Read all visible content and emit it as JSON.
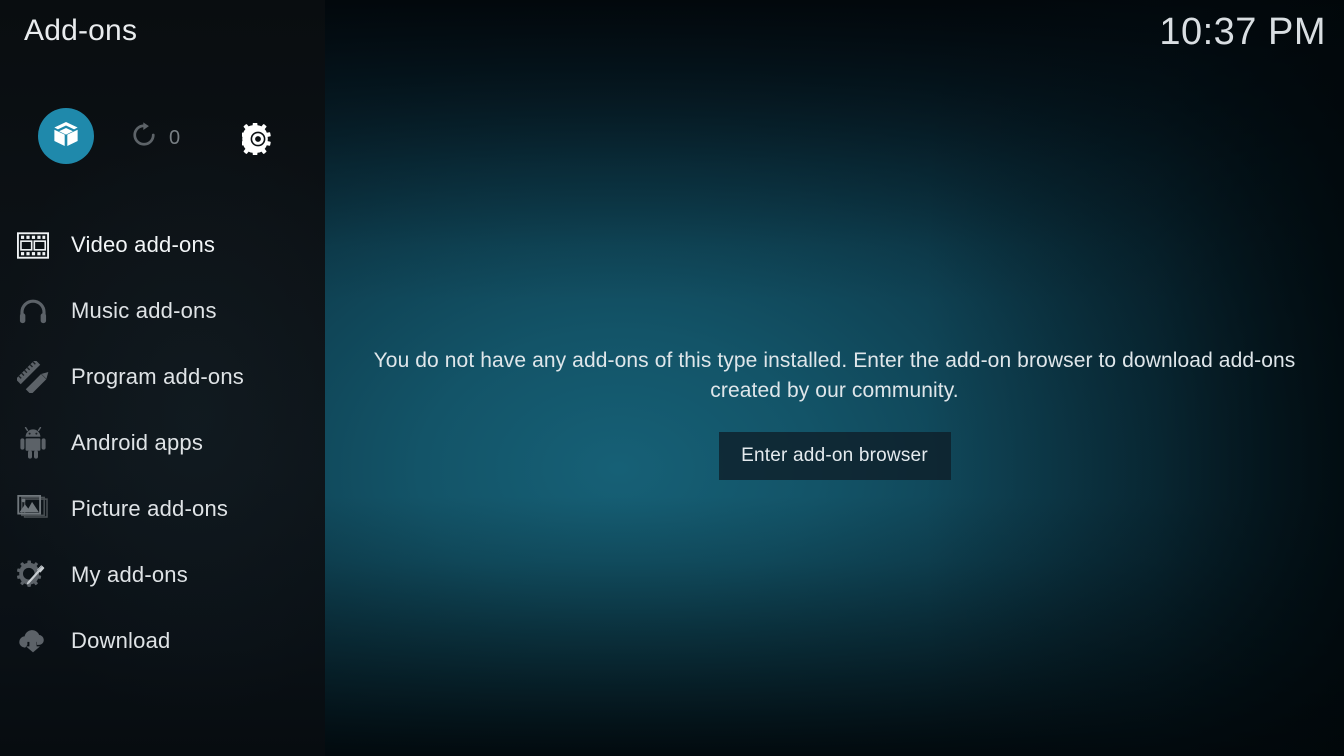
{
  "header": {
    "title": "Add-ons",
    "clock": "10:37 PM"
  },
  "toolbar": {
    "addons_icon": "package-box-icon",
    "update_icon": "refresh-arrow-icon",
    "update_count": "0",
    "settings_icon": "gear-icon"
  },
  "sidebar": {
    "items": [
      {
        "label": "Video add-ons",
        "icon": "film-strip-icon",
        "selected": true
      },
      {
        "label": "Music add-ons",
        "icon": "headphones-icon",
        "selected": false
      },
      {
        "label": "Program add-ons",
        "icon": "pencil-ruler-icon",
        "selected": false
      },
      {
        "label": "Android apps",
        "icon": "android-robot-icon",
        "selected": false
      },
      {
        "label": "Picture add-ons",
        "icon": "picture-frame-icon",
        "selected": false
      },
      {
        "label": "My add-ons",
        "icon": "gear-screwdriver-icon",
        "selected": false
      },
      {
        "label": "Download",
        "icon": "cloud-download-icon",
        "selected": false
      }
    ]
  },
  "main": {
    "empty_message": "You do not have any add-ons of this type installed. Enter the add-on browser to download add-ons created by our community.",
    "browser_button_label": "Enter add-on browser"
  },
  "colors": {
    "accent_circle": "#1f89ab",
    "background_teal": "#166076",
    "sidebar": "#0c1115",
    "text_primary": "#dfe3e6",
    "icon_dim": "#565c60",
    "icon_active": "#f2f5f7"
  }
}
